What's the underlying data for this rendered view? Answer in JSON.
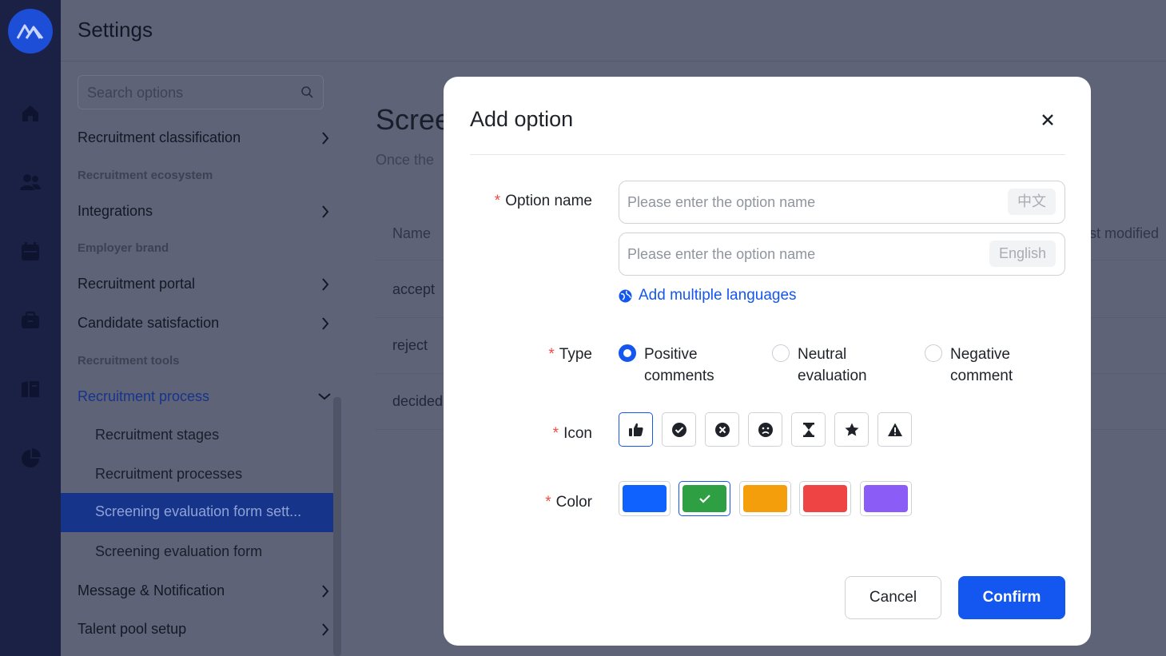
{
  "header": {
    "title": "Settings"
  },
  "sidebar": {
    "search_placeholder": "Search options",
    "items": [
      {
        "label": "Recruitment classification"
      },
      {
        "section": "Recruitment ecosystem"
      },
      {
        "label": "Integrations"
      },
      {
        "section": "Employer brand"
      },
      {
        "label": "Recruitment portal"
      },
      {
        "label": "Candidate satisfaction"
      },
      {
        "section": "Recruitment tools"
      },
      {
        "label": "Recruitment process"
      },
      {
        "label": "Recruitment stages"
      },
      {
        "label": "Recruitment processes"
      },
      {
        "label": "Screening evaluation form sett..."
      },
      {
        "label": "Screening evaluation form"
      },
      {
        "label": "Message & Notification"
      },
      {
        "label": "Talent pool setup"
      }
    ]
  },
  "main": {
    "title": "Scree",
    "description": "Once the",
    "columns": {
      "name": "Name",
      "last_modified": "st modified"
    },
    "rows": [
      "accept",
      "reject",
      "decided"
    ]
  },
  "modal": {
    "title": "Add option",
    "option_name_label": "Option name",
    "inputs": [
      {
        "placeholder": "Please enter the option name",
        "lang": "中文"
      },
      {
        "placeholder": "Please enter the option name",
        "lang": "English"
      }
    ],
    "add_languages": "Add multiple languages",
    "type_label": "Type",
    "types": [
      {
        "label": "Positive comments",
        "selected": true
      },
      {
        "label": "Neutral evaluation",
        "selected": false
      },
      {
        "label": "Negative comment",
        "selected": false
      }
    ],
    "icon_label": "Icon",
    "icons": [
      "thumbs-up-icon",
      "check-circle-icon",
      "x-circle-icon",
      "frown-icon",
      "hourglass-icon",
      "star-icon",
      "warning-icon"
    ],
    "selected_icon": "thumbs-up-icon",
    "color_label": "Color",
    "colors": [
      "#0f62fe",
      "#2ea043",
      "#f59e0b",
      "#ef4444",
      "#8b5cf6"
    ],
    "selected_color": "#2ea043",
    "cancel_label": "Cancel",
    "confirm_label": "Confirm"
  }
}
